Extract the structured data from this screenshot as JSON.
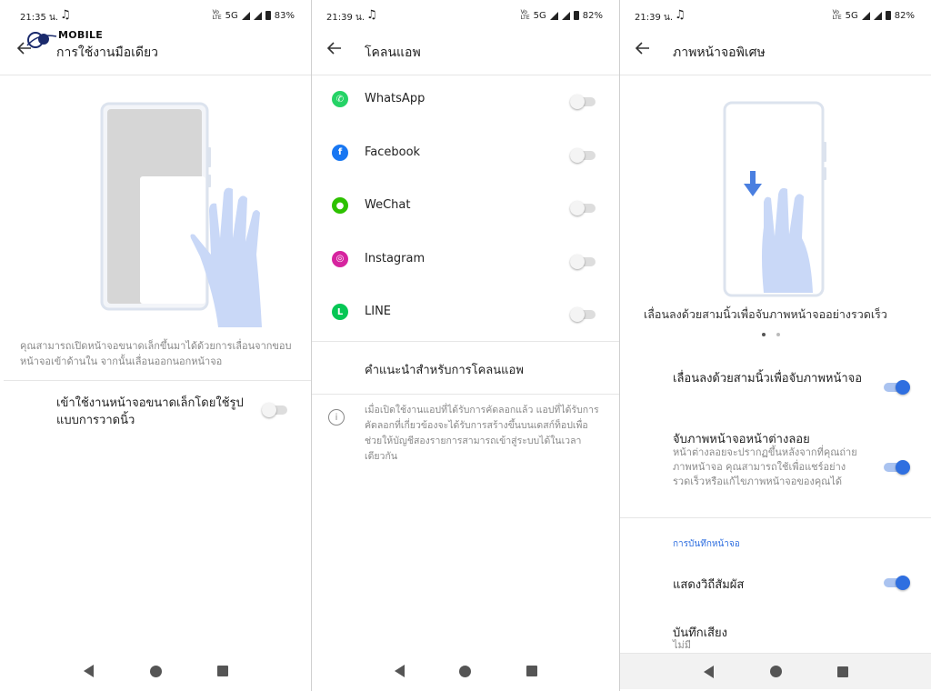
{
  "screen1": {
    "status": {
      "time": "21:35 น.",
      "network": "5G",
      "battery": "83%",
      "vol": "Vo LTE"
    },
    "watermark": "MOBILE",
    "title": "การใช้งานมือเดียว",
    "description": "คุณสามารถเปิดหน้าจอขนาดเล็กขึ้นมาได้ด้วยการเลื่อนจากขอบหน้าจอเข้าด้านใน จากนั้นเลื่อนออกนอกหน้าจอ",
    "setting_label": "เข้าใช้งานหน้าจอขนาดเล็กโดยใช้รูปแบบการวาดนิ้ว",
    "setting_on": false
  },
  "screen2": {
    "status": {
      "time": "21:39 น.",
      "network": "5G",
      "battery": "82%",
      "vol": "Vo LTE"
    },
    "title": "โคลนแอพ",
    "apps": [
      {
        "name": "WhatsApp",
        "icon": "whatsapp-icon",
        "color": "#25d366",
        "on": false
      },
      {
        "name": "Facebook",
        "icon": "facebook-icon",
        "color": "#1877f2",
        "on": false
      },
      {
        "name": "WeChat",
        "icon": "wechat-icon",
        "color": "#2dc100",
        "on": false
      },
      {
        "name": "Instagram",
        "icon": "instagram-icon",
        "color": "#d6249f",
        "on": false
      },
      {
        "name": "LINE",
        "icon": "line-icon",
        "color": "#06c755",
        "on": false
      }
    ],
    "recommend_label": "คำแนะนำสำหรับการโคลนแอพ",
    "info_text": "เมื่อเปิดใช้งานแอปที่ได้รับการคัดลอกแล้ว แอปที่ได้รับการคัดลอกที่เกี่ยวข้องจะได้รับการสร้างขึ้นบนเดสก์ท็อปเพื่อช่วยให้บัญชีสองรายการสามารถเข้าสู่ระบบได้ในเวลาเดียวกัน"
  },
  "screen3": {
    "status": {
      "time": "21:39 น.",
      "network": "5G",
      "battery": "82%",
      "vol": "Vo LTE"
    },
    "title": "ภาพหน้าจอพิเศษ",
    "caption": "เลื่อนลงด้วยสามนิ้วเพื่อจับภาพหน้าจออย่างรวดเร็ว",
    "settings": [
      {
        "label": "เลื่อนลงด้วยสามนิ้วเพื่อจับภาพหน้าจอ",
        "on": true
      },
      {
        "label": "จับภาพหน้าจอหน้าต่างลอย",
        "sub": "หน้าต่างลอยจะปรากฏขึ้นหลังจากที่คุณถ่ายภาพหน้าจอ คุณสามารถใช้เพื่อแชร์อย่างรวดเร็วหรือแก้ไขภาพหน้าจอของคุณได้",
        "on": true
      }
    ],
    "section_header": "การบันทึกหน้าจอ",
    "show_touches_label": "แสดงวิถีสัมผัส",
    "show_touches_on": true,
    "record_audio_label": "บันทึกเสียง",
    "record_audio_value": "ไม่มี"
  },
  "colors": {
    "accent": "#2f6fe0",
    "hand": "#c9d8f7",
    "phone_frame": "#d9dfe8"
  }
}
